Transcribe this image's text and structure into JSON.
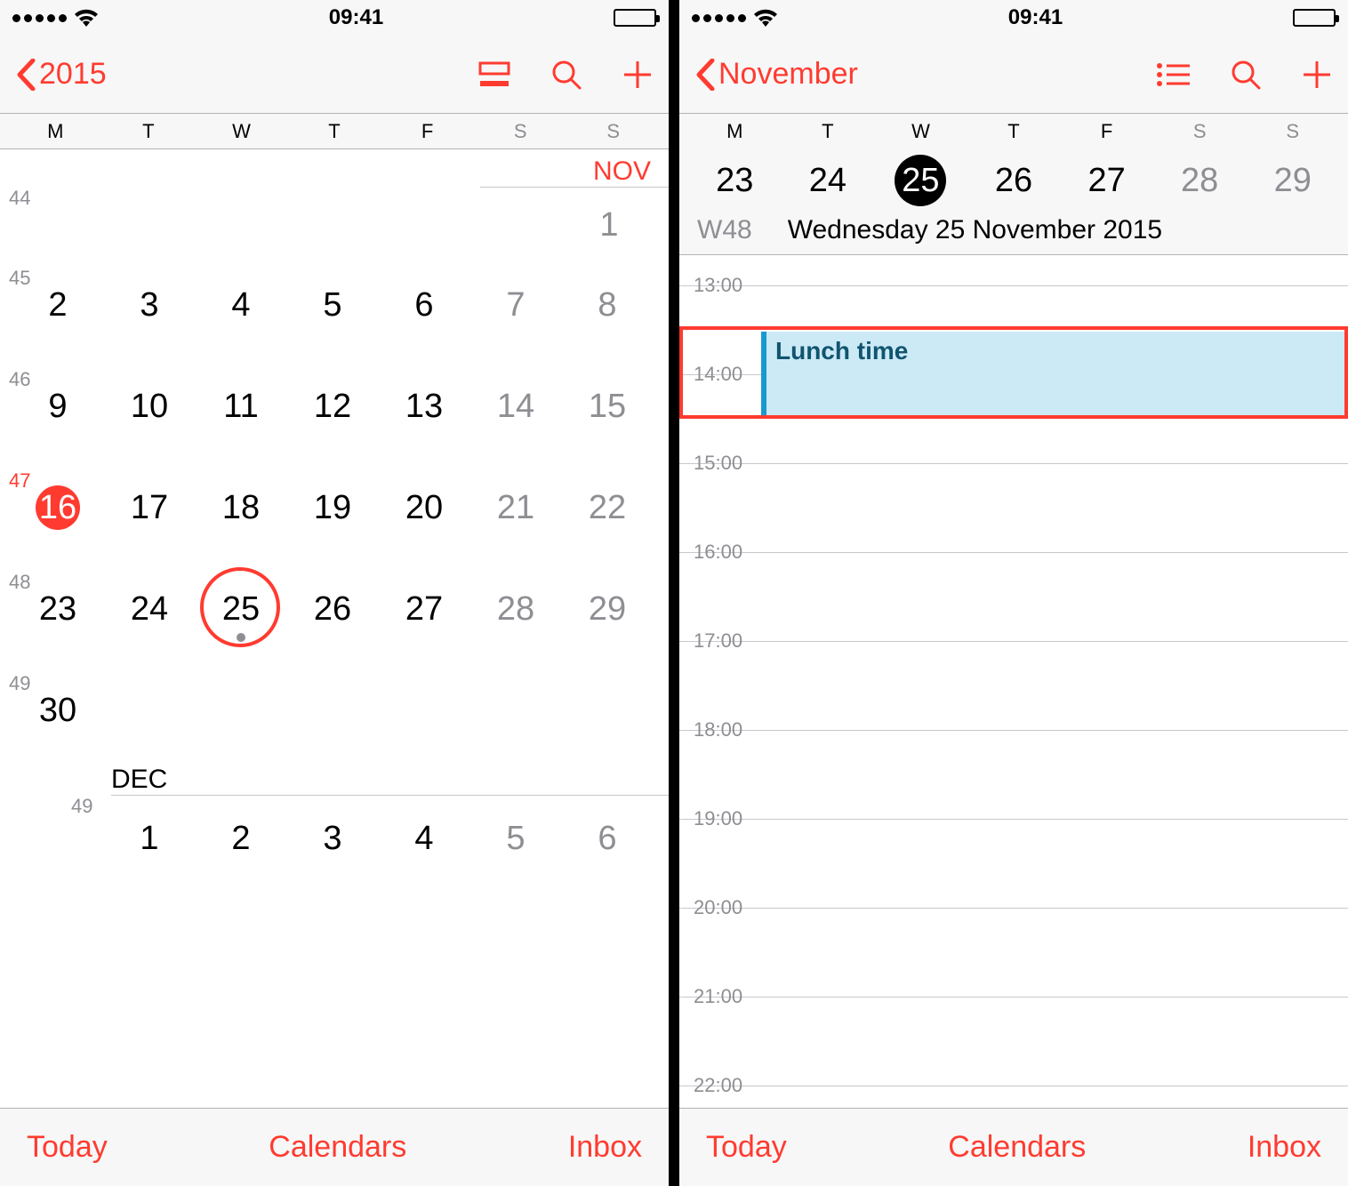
{
  "status": {
    "time": "09:41"
  },
  "left": {
    "back": "2015",
    "weekdays": [
      "M",
      "T",
      "W",
      "T",
      "F",
      "S",
      "S"
    ],
    "month1_label": "NOV",
    "month2_label": "DEC",
    "week_numbers": {
      "w44": "44",
      "w45": "45",
      "w46": "46",
      "w47": "47",
      "w48": "48",
      "w49": "49",
      "w49b": "49"
    },
    "days": {
      "nov1": "1",
      "nov2": "2",
      "nov3": "3",
      "nov4": "4",
      "nov5": "5",
      "nov6": "6",
      "nov7": "7",
      "nov8": "8",
      "nov9": "9",
      "nov10": "10",
      "nov11": "11",
      "nov12": "12",
      "nov13": "13",
      "nov14": "14",
      "nov15": "15",
      "nov16": "16",
      "nov17": "17",
      "nov18": "18",
      "nov19": "19",
      "nov20": "20",
      "nov21": "21",
      "nov22": "22",
      "nov23": "23",
      "nov24": "24",
      "nov25": "25",
      "nov26": "26",
      "nov27": "27",
      "nov28": "28",
      "nov29": "29",
      "nov30": "30",
      "dec1": "1",
      "dec2": "2",
      "dec3": "3",
      "dec4": "4",
      "dec5": "5",
      "dec6": "6"
    }
  },
  "right": {
    "back": "November",
    "weekdays": [
      "M",
      "T",
      "W",
      "T",
      "F",
      "S",
      "S"
    ],
    "strip": {
      "d1": "23",
      "d2": "24",
      "d3": "25",
      "d4": "26",
      "d5": "27",
      "d6": "28",
      "d7": "29"
    },
    "weeknum": "W48",
    "date_long": "Wednesday  25 November 2015",
    "hours": {
      "h13": "13:00",
      "h14": "14:00",
      "h15": "15:00",
      "h16": "16:00",
      "h17": "17:00",
      "h18": "18:00",
      "h19": "19:00",
      "h20": "20:00",
      "h21": "21:00",
      "h22": "22:00"
    },
    "event": "Lunch time"
  },
  "toolbar": {
    "today": "Today",
    "calendars": "Calendars",
    "inbox": "Inbox"
  }
}
